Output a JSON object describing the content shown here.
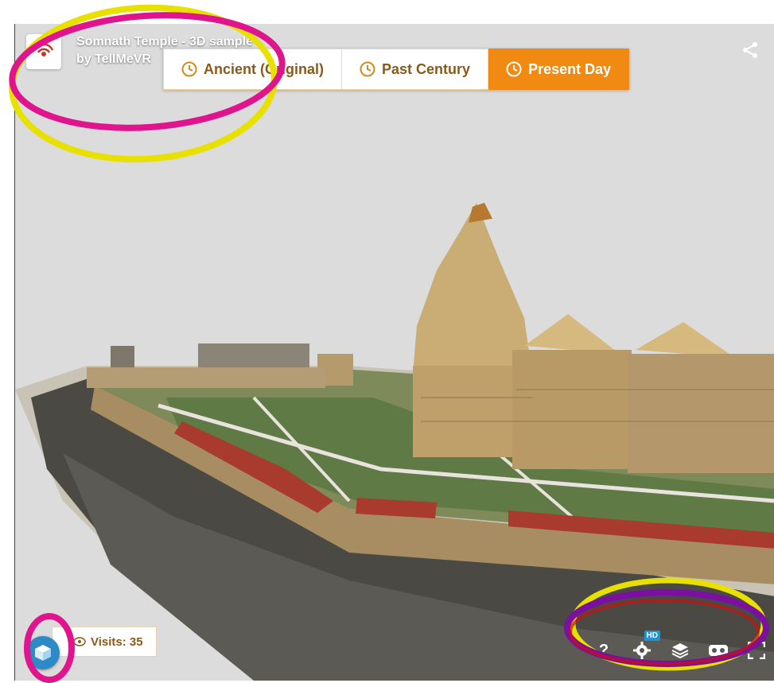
{
  "model": {
    "title": "Somnath Temple - 3D sample",
    "author": "by TellMeVR"
  },
  "tabs": [
    {
      "label": "Ancient (Original)",
      "active": false
    },
    {
      "label": "Past Century",
      "active": false
    },
    {
      "label": "Present Day",
      "active": true
    }
  ],
  "visits": {
    "label": "Visits: 35"
  },
  "controls": {
    "help_label": "?",
    "hd_badge": "HD",
    "icons": [
      "help-icon",
      "settings-icon",
      "layers-icon",
      "vr-headset-icon",
      "fullscreen-icon"
    ]
  },
  "colors": {
    "accent": "#f08a12",
    "tab_text": "#8a5a1a",
    "annotation_magenta": "#e0148c",
    "annotation_yellow": "#e8e000",
    "annotation_purple": "#7a0fa0",
    "annotation_red": "#cc1010"
  }
}
